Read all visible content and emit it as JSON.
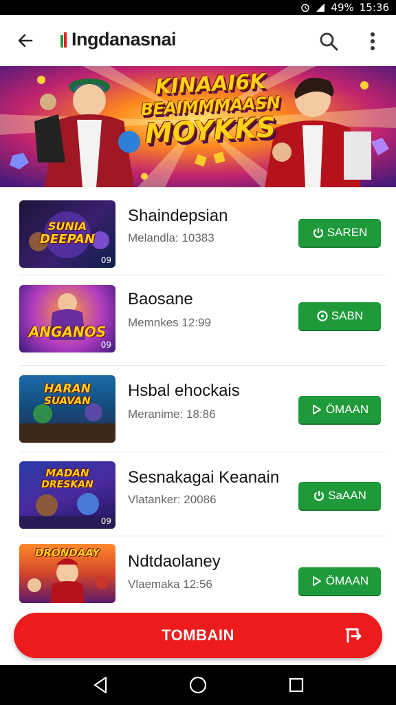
{
  "status_bar": {
    "battery_text": "49%",
    "time": "15:36"
  },
  "app_bar": {
    "title": "Ingdanasnai",
    "back_icon": "arrow-left-icon",
    "search_icon": "search-icon",
    "more_icon": "more-vert-icon"
  },
  "banner": {
    "line1": "KINAAI6K",
    "line2": "BEAIMMMAASN",
    "line3": "MOYKKS"
  },
  "games": [
    {
      "thumb_title_1": "SUNIA",
      "thumb_title_2": "DEEPAN",
      "thumb_badge": "09",
      "title": "Shaindepsian",
      "subtitle": "Melandla: 10383",
      "button_label": "SAREN",
      "button_icon": "power-icon"
    },
    {
      "thumb_title_1": "ANGANOS",
      "thumb_title_2": "",
      "thumb_badge": "09",
      "title": "Baosane",
      "subtitle": "Memnkes 12:99",
      "button_label": "SABN",
      "button_icon": "location-icon"
    },
    {
      "thumb_title_1": "HARAN",
      "thumb_title_2": "SUAVAN",
      "thumb_badge": "",
      "title": "Hsbal ehockais",
      "subtitle": "Meranime: 18:86",
      "button_label": "ÖMAAN",
      "button_icon": "play-icon"
    },
    {
      "thumb_title_1": "MADAN",
      "thumb_title_2": "DRESKAN",
      "thumb_badge": "09",
      "title": "Sesnakagai Keanain",
      "subtitle": "Vlatanker: 20086",
      "button_label": "SaAAN",
      "button_icon": "power-icon"
    },
    {
      "thumb_title_1": "DRONDAAY",
      "thumb_title_2": "",
      "thumb_badge": "",
      "title": "Ndtdaolaney",
      "subtitle": "Vlaemaka 12:56",
      "button_label": "ÖMAAN",
      "button_icon": "play-icon"
    }
  ],
  "main_button": {
    "label": "TOMBAIN",
    "icon": "exit-icon"
  },
  "colors": {
    "accent_red": "#ed1b1b",
    "button_green": "#1f9a3a",
    "banner_yellow": "#ffd21a"
  }
}
